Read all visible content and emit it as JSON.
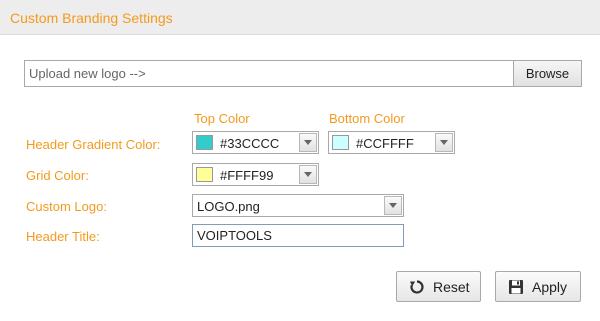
{
  "panel": {
    "title": "Custom Branding Settings"
  },
  "upload": {
    "placeholder": "Upload new logo -->",
    "browse_label": "Browse"
  },
  "columns": {
    "top": "Top Color",
    "bottom": "Bottom Color"
  },
  "rows": {
    "header_gradient": {
      "label": "Header Gradient Color:",
      "top": {
        "value": "#33CCCC",
        "swatch": "#33CCCC"
      },
      "bottom": {
        "value": "#CCFFFF",
        "swatch": "#CCFFFF"
      }
    },
    "grid": {
      "label": "Grid Color:",
      "value": "#FFFF99",
      "swatch": "#FFFF99"
    },
    "custom_logo": {
      "label": "Custom Logo:",
      "value": "LOGO.png"
    },
    "header_title": {
      "label": "Header Title:",
      "value": "VOIPTOOLS"
    }
  },
  "buttons": {
    "reset": "Reset",
    "apply": "Apply"
  },
  "icons": {
    "reset": "reset-icon",
    "apply": "save-icon",
    "dropdown": "chevron-down-icon"
  },
  "colors": {
    "accent": "#F39A1E",
    "header_bg": "#EDEDED"
  }
}
